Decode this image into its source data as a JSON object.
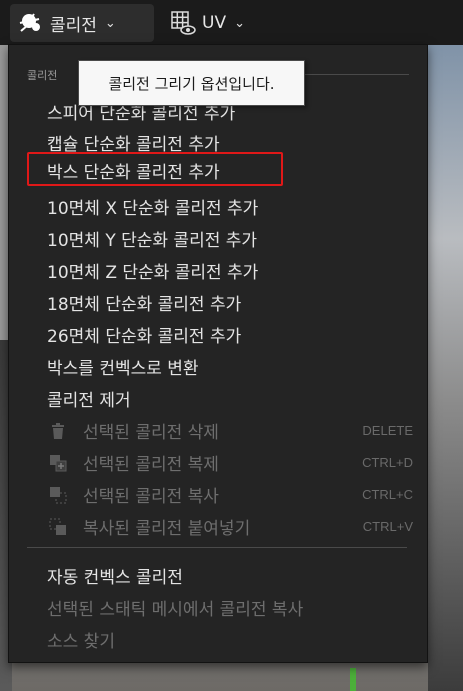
{
  "toolbar": {
    "collision_label": "콜리전",
    "uv_label": "UV",
    "collision_icon": "collision-splat-icon",
    "uv_icon": "grid-eye-icon"
  },
  "menu": {
    "section_header": "콜리전",
    "items": [
      {
        "label": "스피어 단순화 콜리전 추가"
      },
      {
        "label": "캡슐 단순화 콜리전 추가"
      },
      {
        "label": "박스 단순화 콜리전 추가"
      },
      {
        "label": "10면체 X 단순화 콜리전 추가"
      },
      {
        "label": "10면체 Y 단순화 콜리전 추가"
      },
      {
        "label": "10면체 Z 단순화 콜리전 추가"
      },
      {
        "label": "18면체 단순화 콜리전 추가"
      },
      {
        "label": "26면체 단순화 콜리전 추가"
      },
      {
        "label": "박스를 컨벡스로 변환"
      },
      {
        "label": "콜리전 제거"
      },
      {
        "label": "선택된 콜리전 삭제",
        "shortcut": "DELETE",
        "icon": "trash-icon"
      },
      {
        "label": "선택된 콜리전 복제",
        "shortcut": "CTRL+D",
        "icon": "duplicate-icon"
      },
      {
        "label": "선택된 콜리전 복사",
        "shortcut": "CTRL+C",
        "icon": "copy-icon"
      },
      {
        "label": "복사된 콜리전 붙여넣기",
        "shortcut": "CTRL+V",
        "icon": "paste-icon"
      },
      {
        "label": "자동 컨벡스 콜리전"
      },
      {
        "label": "선택된 스태틱 메시에서 콜리전 복사"
      },
      {
        "label": "소스 찾기"
      }
    ]
  },
  "tooltip": {
    "text": "콜리전 그리기 옵션입니다."
  },
  "colors": {
    "highlight": "#e01818",
    "menu_bg": "#242424",
    "tooltip_bg": "#f7f7f7"
  }
}
